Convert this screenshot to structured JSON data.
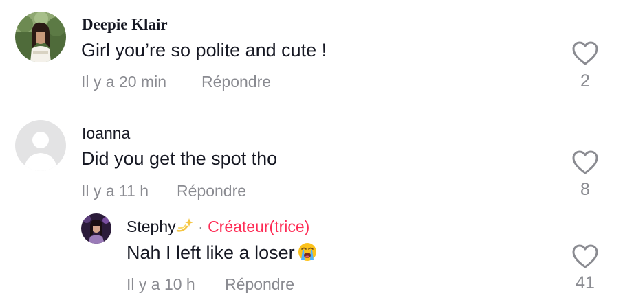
{
  "comments": [
    {
      "author": "Deepie Klair",
      "text": "Girl you’re so polite and cute !",
      "time": "Il y a 20 min",
      "reply_label": "Répondre",
      "likes": "2"
    },
    {
      "author": "Ioanna",
      "text": "Did you get the spot tho",
      "time": "Il y a 11 h",
      "reply_label": "Répondre",
      "likes": "8"
    }
  ],
  "reply": {
    "author": "Stephy",
    "separator": "·",
    "creator_label": "Créateur(trice)",
    "text": "Nah I left like a loser",
    "time": "Il y a 10 h",
    "reply_label": "Répondre",
    "likes": "41"
  },
  "colors": {
    "accent": "#fe2c55",
    "secondary_text": "#8a8b91",
    "primary_text": "#161823"
  },
  "icons": {
    "like": "heart-outline-icon",
    "default_avatar": "default-avatar-icon",
    "sparkle": "dizzy-sparkle-emoji",
    "crying": "loudly-crying-face-emoji"
  }
}
